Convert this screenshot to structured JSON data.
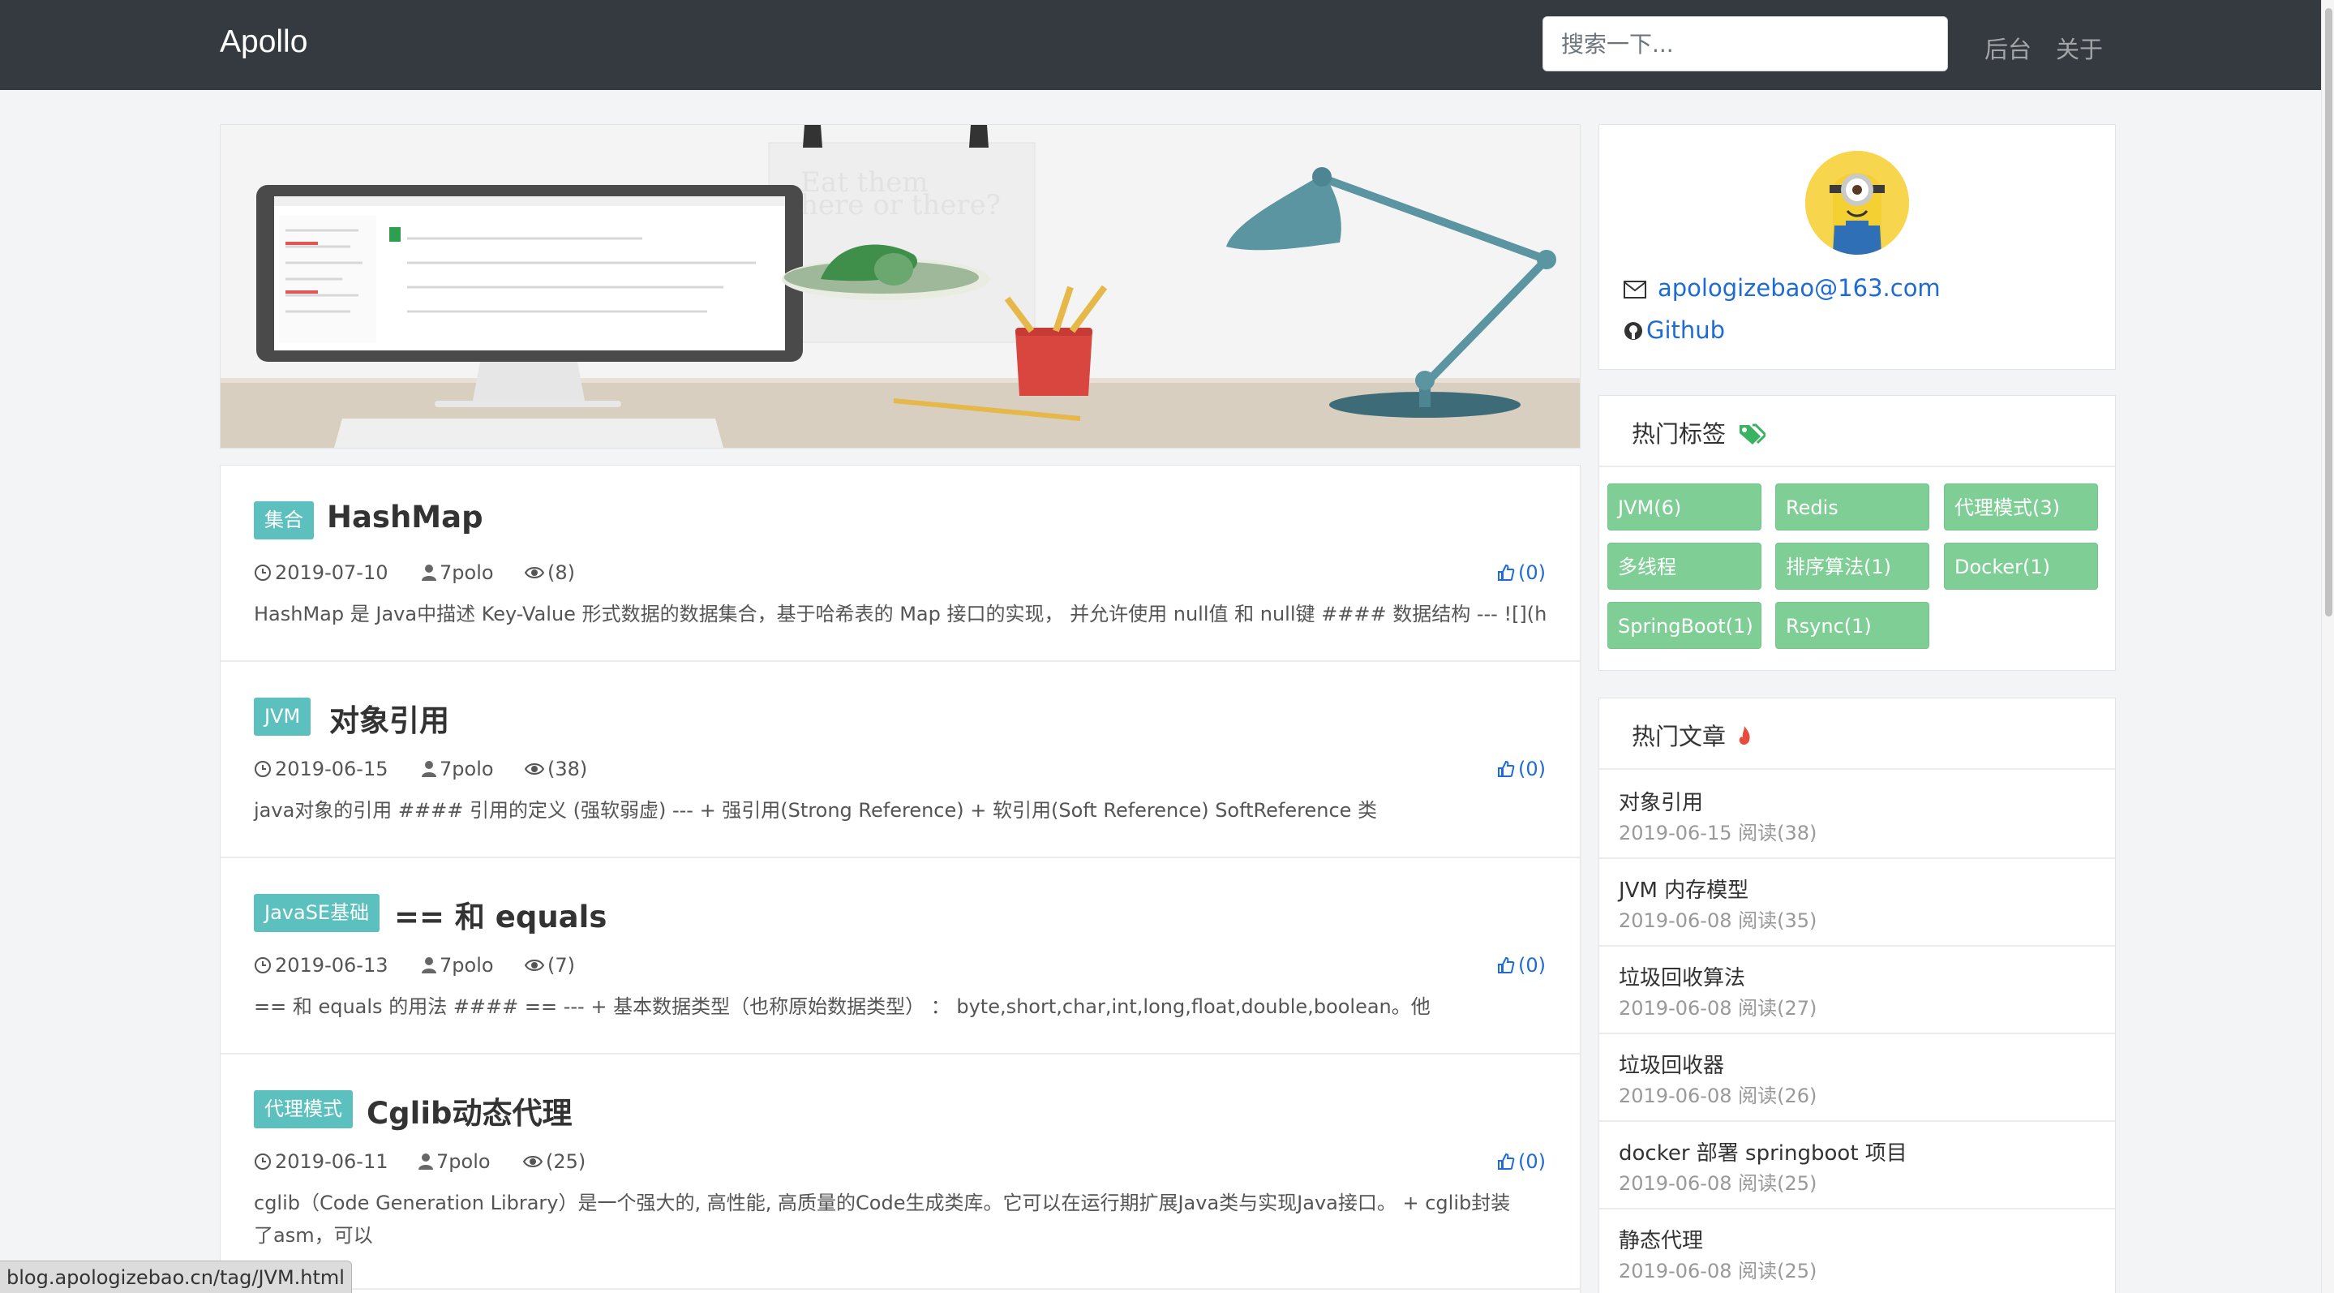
{
  "navbar": {
    "brand": "Apollo",
    "search_placeholder": "搜索一下...",
    "links": [
      "后台",
      "关于"
    ]
  },
  "hero": {
    "poster_text_line1": "Eat them",
    "poster_text_line2": "here or there?"
  },
  "posts": [
    {
      "tag": "集合",
      "title": "HashMap",
      "date": "2019-07-10",
      "author": "7polo",
      "views": "(8)",
      "likes": "(0)",
      "summary": "HashMap 是 Java中描述 Key-Value 形式数据的数据集合，基于哈希表的 Map 接口的实现， 并允许使用 null值 和 null键 #### 数据结构 --- ![](h"
    },
    {
      "tag": "JVM",
      "title": "对象引用",
      "date": "2019-06-15",
      "author": "7polo",
      "views": "(38)",
      "likes": "(0)",
      "summary": "java对象的引用 #### 引用的定义 (强软弱虚) --- + 强引用(Strong Reference) + 软引用(Soft Reference) SoftReference 类"
    },
    {
      "tag": "JavaSE基础",
      "title": "== 和 equals",
      "date": "2019-06-13",
      "author": "7polo",
      "views": "(7)",
      "likes": "(0)",
      "summary": "== 和 equals 的用法 #### == --- + 基本数据类型（也称原始数据类型） ： byte,short,char,int,long,float,double,boolean。他"
    },
    {
      "tag": "代理模式",
      "title": "Cglib动态代理",
      "date": "2019-06-11",
      "author": "7polo",
      "views": "(25)",
      "likes": "(0)",
      "summary": "cglib（Code Generation Library）是一个强大的, 高性能, 高质量的Code生成类库。它可以在运行期扩展Java类与实现Java接口。 + cglib封装了asm，可以"
    }
  ],
  "profile": {
    "email": "apologizebao@163.com",
    "github": "Github"
  },
  "hot_tags": {
    "title": "热门标签",
    "tags": [
      "JVM(6)",
      "Redis",
      "代理模式(3)",
      "多线程",
      "排序算法(1)",
      "Docker(1)",
      "SpringBoot(1)",
      "Rsync(1)"
    ]
  },
  "hot_articles": {
    "title": "热门文章",
    "items": [
      {
        "title": "对象引用",
        "meta": "2019-06-15 阅读(38)"
      },
      {
        "title": "JVM 内存模型",
        "meta": "2019-06-08 阅读(35)"
      },
      {
        "title": "垃圾回收算法",
        "meta": "2019-06-08 阅读(27)"
      },
      {
        "title": "垃圾回收器",
        "meta": "2019-06-08 阅读(26)"
      },
      {
        "title": "docker 部署 springboot 项目",
        "meta": "2019-06-08 阅读(25)"
      },
      {
        "title": "静态代理",
        "meta": "2019-06-08 阅读(25)"
      }
    ]
  },
  "status_bar": {
    "url": "blog.apologizebao.cn/tag/JVM.html"
  },
  "colors": {
    "navbar_bg": "#343a40",
    "tag_teal": "#5bc0be",
    "tag_green": "#7fce96",
    "link_blue": "#1e6bd6"
  }
}
